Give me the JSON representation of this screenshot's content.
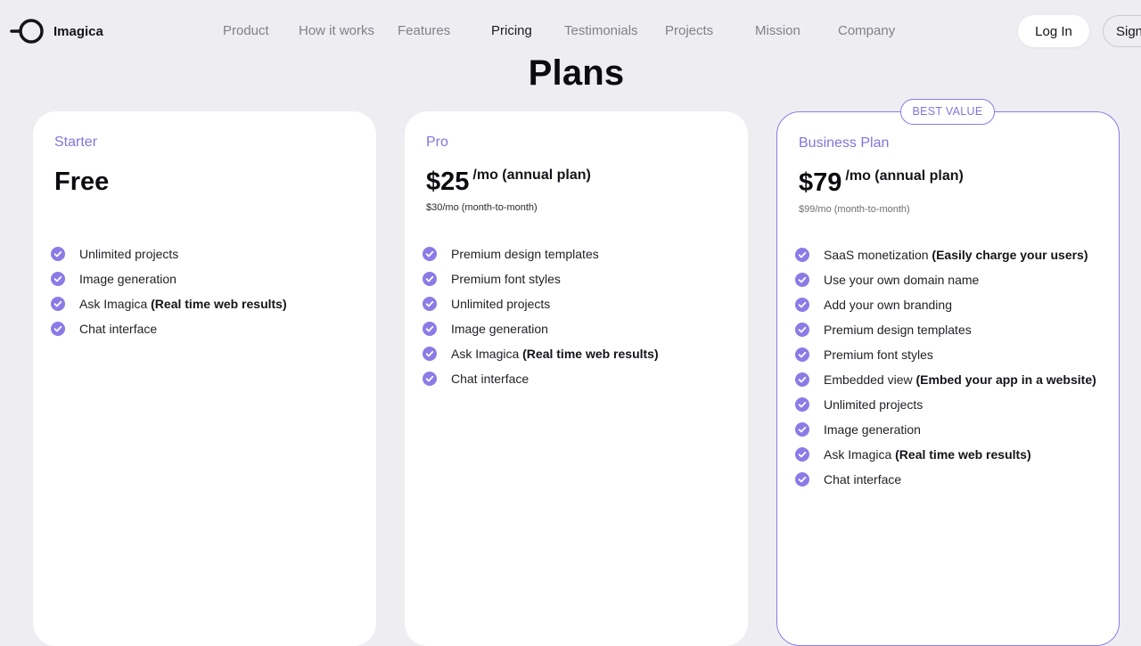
{
  "brand": {
    "name": "Imagica"
  },
  "nav": {
    "items": [
      {
        "label": "Product"
      },
      {
        "label": "How it works"
      },
      {
        "label": "Features"
      },
      {
        "label": "Pricing"
      },
      {
        "label": "Testimonials"
      },
      {
        "label": "Projects"
      },
      {
        "label": "Mission"
      },
      {
        "label": "Company"
      }
    ],
    "active": "Pricing",
    "login_label": "Log In",
    "signup_label": "Sign"
  },
  "page": {
    "title": "Plans"
  },
  "colors": {
    "accent": "#8474db",
    "check": "#8b7be6",
    "background": "#eeeef2",
    "card": "#ffffff"
  },
  "plans": [
    {
      "name": "Starter",
      "price": "Free",
      "price_suffix": "",
      "price_note": "",
      "features": [
        {
          "text": "Unlimited projects",
          "emphasis": ""
        },
        {
          "text": "Image generation",
          "emphasis": ""
        },
        {
          "text": "Ask Imagica",
          "emphasis": "(Real time web results)"
        },
        {
          "text": "Chat interface",
          "emphasis": ""
        }
      ]
    },
    {
      "name": "Pro",
      "price": "$25",
      "price_suffix": "/mo (annual plan)",
      "price_note": "$30/mo (month-to-month)",
      "features": [
        {
          "text": "Premium design templates",
          "emphasis": ""
        },
        {
          "text": "Premium font styles",
          "emphasis": ""
        },
        {
          "text": "Unlimited projects",
          "emphasis": ""
        },
        {
          "text": "Image generation",
          "emphasis": ""
        },
        {
          "text": "Ask Imagica",
          "emphasis": "(Real time web results)"
        },
        {
          "text": "Chat interface",
          "emphasis": ""
        }
      ]
    },
    {
      "name": "Business Plan",
      "badge": "BEST VALUE",
      "price": "$79",
      "price_suffix": "/mo (annual plan)",
      "price_note": "$99/mo (month-to-month)",
      "features": [
        {
          "text": "SaaS monetization",
          "emphasis": "(Easily charge your users)"
        },
        {
          "text": "Use your own domain name",
          "emphasis": ""
        },
        {
          "text": "Add your own branding",
          "emphasis": ""
        },
        {
          "text": "Premium design templates",
          "emphasis": ""
        },
        {
          "text": "Premium font styles",
          "emphasis": ""
        },
        {
          "text": "Embedded view",
          "emphasis": "(Embed your app in a website)"
        },
        {
          "text": "Unlimited projects",
          "emphasis": ""
        },
        {
          "text": "Image generation",
          "emphasis": ""
        },
        {
          "text": "Ask Imagica",
          "emphasis": "(Real time web results)"
        },
        {
          "text": "Chat interface",
          "emphasis": ""
        }
      ]
    }
  ]
}
